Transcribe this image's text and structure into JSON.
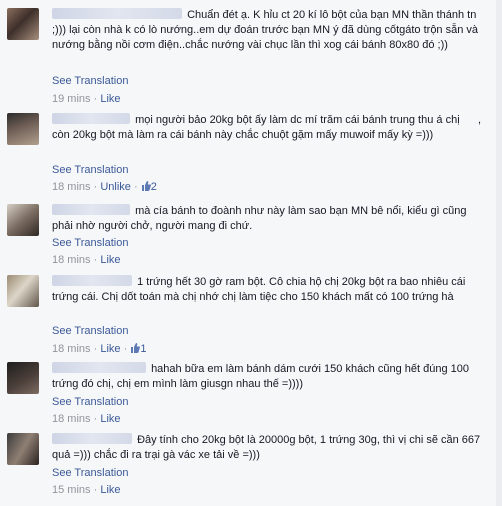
{
  "comments": [
    {
      "text": "Chuẩn đét ạ. K hỉu ct 20 kí lô bột của bạn MN thần thánh tn ;))) lại còn nhà k có lò nướng..em dự đoán trước bạn MN ý đã dùng cốtgáto trộn sẵn và nướng bằng nồi cơm điện..chắc nướng vài chục lần thì xog cái bánh 80x80 đó ;))",
      "translate": "See Translation",
      "time": "19 mins",
      "sep": "·",
      "like": "Like"
    },
    {
      "text": "mọi người bảo 20kg bột ấy làm dc mí trăm cái bánh trung thu á chị      , còn 20kg bột mà làm ra cái bánh này chắc chuột gặm mấy muwoif mấy kỳ =)))",
      "translate": "See Translation",
      "time": "18 mins",
      "sep": "·",
      "like": "Unlike",
      "count": "2"
    },
    {
      "text": "mà cía bánh to đoành như này làm sao bạn MN bê nổi, kiểu gì cũng phải nhờ người chở, người mang đi chứ.",
      "translate": "See Translation",
      "time": "18 mins",
      "sep": "·",
      "like": "Like"
    },
    {
      "text": "1 trứng hết 30 gờ ram bột. Cô chia hộ chị 20kg bột ra bao nhiêu cái trứng cái. Chị dốt toán mà chị nhớ chị làm tiệc cho 150 khách mất có 100 trứng hà",
      "translate": "See Translation",
      "time": "18 mins",
      "sep": "·",
      "like": "Like",
      "count": "1"
    },
    {
      "text": "hahah bữa em làm bánh dám cưới 150 khách cũng hết đúng 100 trứng đó chị, chị em mình làm giusgn nhau thế =))))",
      "translate": "See Translation",
      "time": "18 mins",
      "sep": "·",
      "like": "Like"
    },
    {
      "text": "Đây tính cho 20kg bột là 20000g bột, 1 trứng 30g, thì vị chi sẽ cần 667 quả =))) chắc đi ra trại gà vác xe tải về =)))",
      "translate": "See Translation",
      "time": "15 mins",
      "sep": "·",
      "like": "Like"
    }
  ],
  "colors": {
    "link": "#3b5998",
    "meta": "#90949c",
    "text": "#141823",
    "bg": "#f6f7f9"
  },
  "icons": {
    "like": "thumbs-up-icon"
  }
}
